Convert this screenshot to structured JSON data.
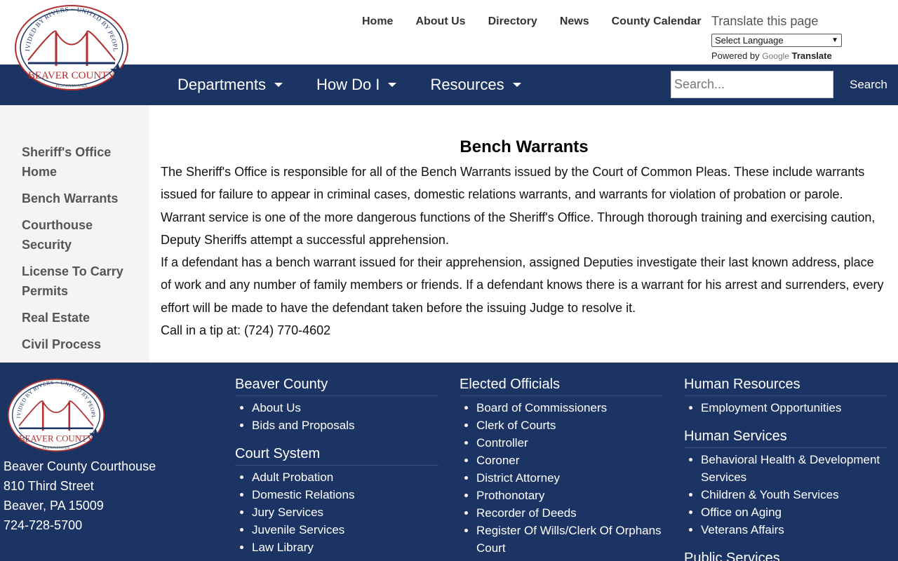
{
  "header": {
    "logo": {
      "motto": "DIVIDED BY RIVERS ~ UNITED BY PEOPLE",
      "name": "BEAVER COUNTY",
      "state": "PENNSYLVANIA"
    },
    "topnav": [
      "Home",
      "About Us",
      "Directory",
      "News",
      "County Calendar"
    ],
    "translate": {
      "title": "Translate this page",
      "select_value": "Select Language",
      "powered_by": "Powered by",
      "google": "Google",
      "translate": "Translate"
    }
  },
  "nav": {
    "menus": [
      "Departments",
      "How Do I",
      "Resources"
    ],
    "search_placeholder": "Search...",
    "search_button": "Search"
  },
  "sidebar": {
    "items": [
      "Sheriff's Office Home",
      "Bench Warrants",
      "Courthouse Security",
      "License To Carry Permits",
      "Real Estate",
      "Civil Process"
    ]
  },
  "main": {
    "title": "Bench Warrants",
    "paragraphs": [
      "The Sheriff's Office is responsible for all of the Bench Warrants issued by the Court of Common Pleas. These include warrants issued for failure to appear in criminal cases, domestic relations warrants, and warrants for violation of probation or parole. Warrant service is one of the more dangerous functions of the Sheriff's Office. Through thorough training and exercising caution, Deputy Sheriffs attempt a successful apprehension.",
      "If a defendant has a bench warrant issued for their apprehension, assigned Deputies investigate their last known address, place of work and any number of family members or friends. If a defendant knows there is a warrant for his arrest and surrenders, every effort will be made to have the defendant taken before the issuing Judge to resolve it.",
      "Call in a tip at: (724) 770-4602"
    ]
  },
  "footer": {
    "address": [
      "Beaver County Courthouse",
      "810 Third Street",
      "Beaver, PA 15009",
      "724-728-5700"
    ],
    "beaver_county": {
      "heading": "Beaver County",
      "links": [
        "About Us",
        "Bids and Proposals"
      ]
    },
    "court_system": {
      "heading": "Court System",
      "links": [
        "Adult Probation",
        "Domestic Relations",
        "Jury Services",
        "Juvenile Services",
        "Law Library"
      ]
    },
    "elected_officials": {
      "heading": "Elected Officials",
      "links": [
        "Board of Commissioners",
        "Clerk of Courts",
        "Controller",
        "Coroner",
        "District Attorney",
        "Prothonotary",
        "Recorder of Deeds",
        "Register Of Wills/Clerk Of Orphans Court"
      ]
    },
    "human_resources": {
      "heading": "Human Resources",
      "links": [
        "Employment Opportunities"
      ]
    },
    "human_services": {
      "heading": "Human Services",
      "links": [
        "Behavioral Health & Development Services",
        "Children & Youth Services",
        "Office on Aging",
        "Veterans Affairs"
      ]
    },
    "public_services_heading": "Public Services"
  },
  "colors": {
    "navy": "#1c3464",
    "logo_red": "#b22f2f",
    "logo_blue": "#1c3464"
  }
}
